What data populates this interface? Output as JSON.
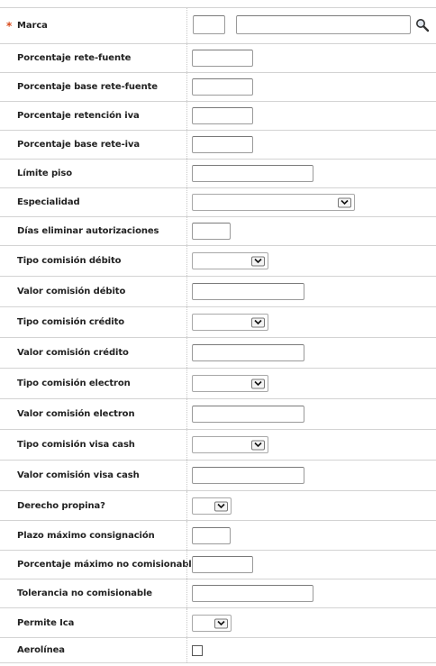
{
  "required_marker": "*",
  "fields": {
    "marca": {
      "label": "Marca",
      "code": "",
      "name": ""
    },
    "porcentaje_rete_fuente": {
      "label": "Porcentaje rete-fuente",
      "value": ""
    },
    "porcentaje_base_rete_fuente": {
      "label": "Porcentaje base rete-fuente",
      "value": ""
    },
    "porcentaje_retencion_iva": {
      "label": "Porcentaje retención iva",
      "value": ""
    },
    "porcentaje_base_rete_iva": {
      "label": "Porcentaje base rete-iva",
      "value": ""
    },
    "limite_piso": {
      "label": "Límite piso",
      "value": ""
    },
    "especialidad": {
      "label": "Especialidad",
      "selected": ""
    },
    "dias_eliminar_autorizaciones": {
      "label": "Días eliminar autorizaciones",
      "value": ""
    },
    "tipo_comision_debito": {
      "label": "Tipo comisión débito",
      "selected": ""
    },
    "valor_comision_debito": {
      "label": "Valor comisión débito",
      "value": ""
    },
    "tipo_comision_credito": {
      "label": "Tipo comisión crédito",
      "selected": ""
    },
    "valor_comision_credito": {
      "label": "Valor comisión crédito",
      "value": ""
    },
    "tipo_comision_electron": {
      "label": "Tipo comisión electron",
      "selected": ""
    },
    "valor_comision_electron": {
      "label": "Valor comisión electron",
      "value": ""
    },
    "tipo_comision_visa_cash": {
      "label": "Tipo comisión visa cash",
      "selected": ""
    },
    "valor_comision_visa_cash": {
      "label": "Valor comisión visa cash",
      "value": ""
    },
    "derecho_propina": {
      "label": "Derecho propina?",
      "selected": ""
    },
    "plazo_maximo_consignacion": {
      "label": "Plazo máximo consignación",
      "value": ""
    },
    "porcentaje_maximo_no_comisionable": {
      "label": "Porcentaje máximo no comisionable",
      "value": ""
    },
    "tolerancia_no_comisionable": {
      "label": "Tolerancia no comisionable",
      "value": ""
    },
    "permite_ica": {
      "label": "Permite Ica",
      "selected": ""
    },
    "aerolinea": {
      "label": "Aerolínea",
      "checked": false
    }
  },
  "icons": {
    "search": "magnifier-icon",
    "dropdown": "chevron-down-icon"
  }
}
